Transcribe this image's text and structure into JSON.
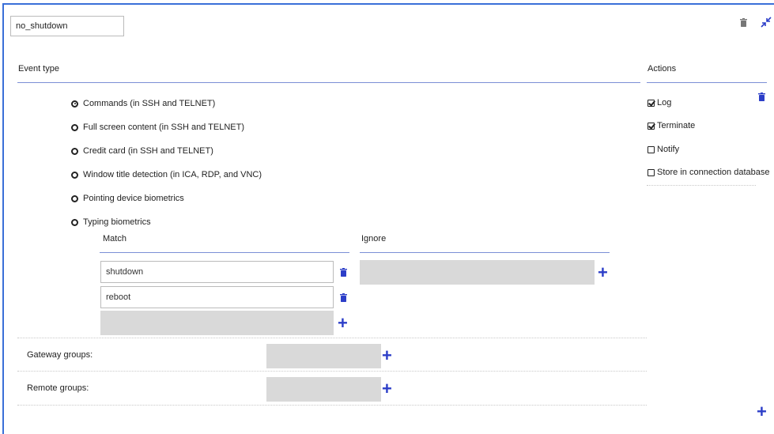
{
  "policy": {
    "name": "no_shutdown"
  },
  "header": {
    "delete_icon": "trash-icon",
    "collapse_icon": "collapse-arrows-icon"
  },
  "event_type": {
    "title": "Event type",
    "options": [
      {
        "label": "Commands (in SSH and TELNET)",
        "selected": true
      },
      {
        "label": "Full screen content (in SSH and TELNET)",
        "selected": false
      },
      {
        "label": "Credit card (in SSH and TELNET)",
        "selected": false
      },
      {
        "label": "Window title detection (in ICA, RDP, and VNC)",
        "selected": false
      },
      {
        "label": "Pointing device biometrics",
        "selected": false
      },
      {
        "label": "Typing biometrics",
        "selected": false
      }
    ]
  },
  "match": {
    "title": "Match",
    "entries": [
      "shutdown",
      "reboot"
    ]
  },
  "ignore": {
    "title": "Ignore"
  },
  "gateway_groups": {
    "label": "Gateway groups:"
  },
  "remote_groups": {
    "label": "Remote groups:"
  },
  "actions": {
    "title": "Actions",
    "items": [
      {
        "label": "Log",
        "checked": true
      },
      {
        "label": "Terminate",
        "checked": true
      },
      {
        "label": "Notify",
        "checked": false
      },
      {
        "label": "Store in connection database",
        "checked": false
      }
    ]
  },
  "colors": {
    "accent": "#2c3ec8",
    "rule": "#7b8fd6",
    "frame": "#3a6fd8",
    "empty_field": "#d9d9d9"
  }
}
